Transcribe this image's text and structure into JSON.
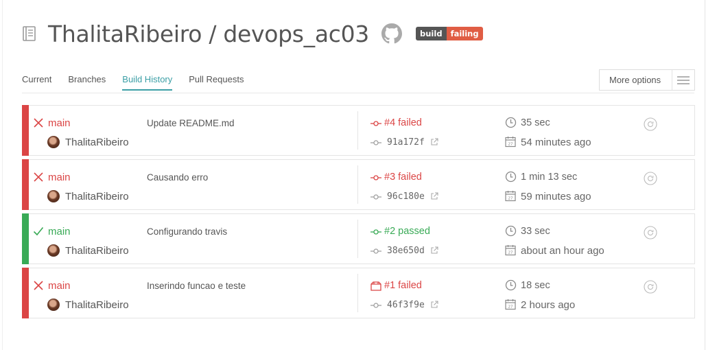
{
  "header": {
    "title": "ThalitaRibeiro / devops_ac03",
    "badge": {
      "left": "build",
      "right": "failing"
    }
  },
  "tabs": [
    {
      "label": "Current",
      "active": false
    },
    {
      "label": "Branches",
      "active": false
    },
    {
      "label": "Build History",
      "active": true
    },
    {
      "label": "Pull Requests",
      "active": false
    }
  ],
  "more_options": {
    "label": "More options"
  },
  "builds": [
    {
      "state": "failed",
      "branch": "main",
      "author": "ThalitaRibeiro",
      "message": "Update README.md",
      "build": "#4 failed",
      "commit": "91a172f",
      "duration": "35 sec",
      "finished": "54 minutes ago",
      "build_icon": "commit-icon"
    },
    {
      "state": "failed",
      "branch": "main",
      "author": "ThalitaRibeiro",
      "message": "Causando erro",
      "build": "#3 failed",
      "commit": "96c180e",
      "duration": "1 min 13 sec",
      "finished": "59 minutes ago",
      "build_icon": "commit-icon"
    },
    {
      "state": "passed",
      "branch": "main",
      "author": "ThalitaRibeiro",
      "message": "Configurando travis",
      "build": "#2 passed",
      "commit": "38e650d",
      "duration": "33 sec",
      "finished": "about an hour ago",
      "build_icon": "commit-icon"
    },
    {
      "state": "failed",
      "branch": "main",
      "author": "ThalitaRibeiro",
      "message": "Inserindo funcao e teste",
      "build": "#1 failed",
      "commit": "46f3f9e",
      "duration": "18 sec",
      "finished": "2 hours ago",
      "build_icon": "push-icon"
    }
  ],
  "colors": {
    "failed": "#db4545",
    "passed": "#39aa56",
    "accent": "#3a9ea5",
    "badge_fail": "#e05d44",
    "badge_dark": "#555555"
  }
}
